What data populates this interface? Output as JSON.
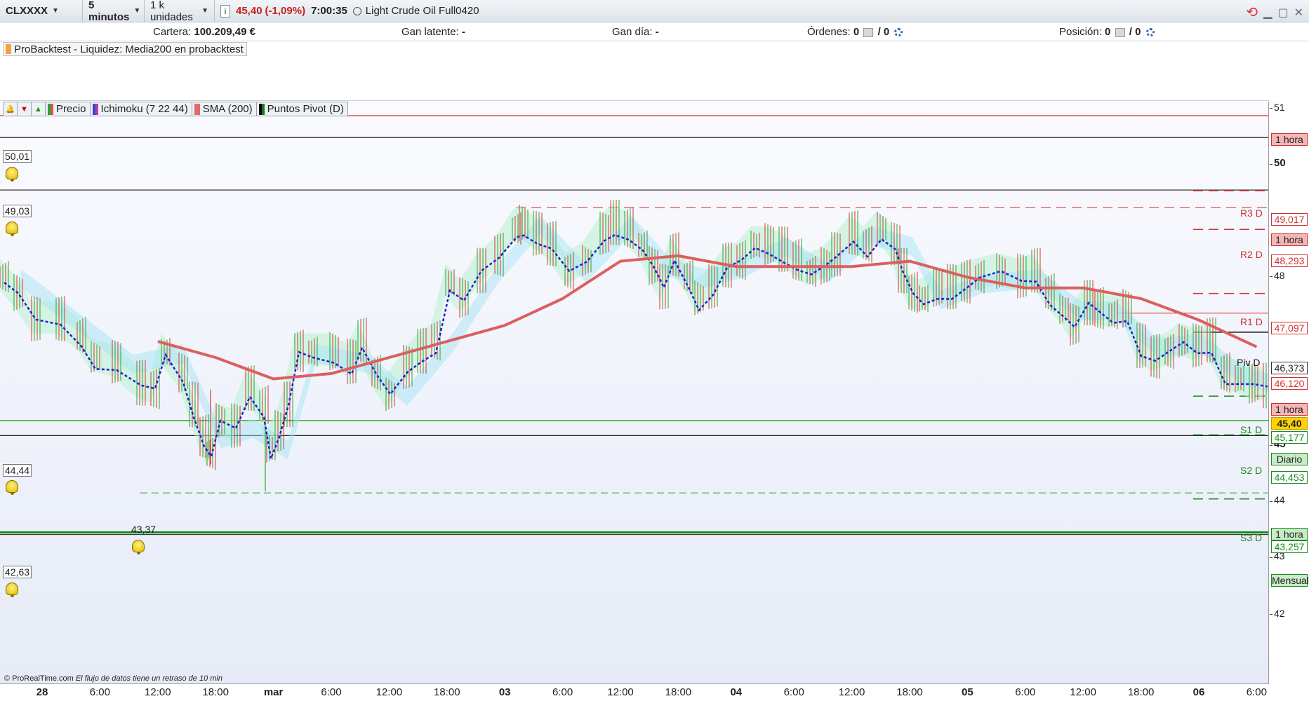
{
  "toolbar": {
    "symbol": "CLXXXX",
    "timeframe": "5 minutos",
    "units": "1 k unidades",
    "info_icon": "info-icon",
    "price": "45,40",
    "change": "(-1,09%)",
    "time": "7:00:35",
    "instrument": "Light Crude Oil Full0420"
  },
  "account": {
    "cartera_label": "Cartera:",
    "cartera_value": "100.209,49 €",
    "latente_label": "Gan latente:",
    "latente_value": "-",
    "dia_label": "Gan día:",
    "dia_value": "-",
    "ordenes_label": "Órdenes:",
    "ordenes_a": "0",
    "ordenes_b": "/ 0",
    "posicion_label": "Posición:",
    "posicion_a": "0",
    "posicion_b": "/ 0"
  },
  "probacktest": {
    "label": "ProBacktest - Liquidez: Media200 en probacktest"
  },
  "legend": {
    "items": [
      {
        "label": "Precio",
        "color": "#e05252"
      },
      {
        "label": "Ichimoku (7 22 44)",
        "color": "#4040d0"
      },
      {
        "label": "SMA (200)",
        "color": "#e06b6b"
      },
      {
        "label": "Puntos Pivot (D)",
        "color": "#1a7a1a"
      }
    ]
  },
  "axis": {
    "ticks": [
      "51",
      "50",
      "48",
      "45",
      "44",
      "43",
      "42"
    ],
    "bold_ticks": [
      "50",
      "45"
    ]
  },
  "lines": {
    "label_50_01": "50,01",
    "label_49_03": "49,03",
    "label_44_44": "44,44",
    "label_43_37": "43,37",
    "label_42_63": "42,63"
  },
  "tags": {
    "hora": "1 hora",
    "r3": "49,017",
    "r2": "48,293",
    "r1": "47,097",
    "piv": "46,373",
    "sma": "46,120",
    "price": "45,40",
    "s1": "45,177",
    "diario": "Diario",
    "s2": "44,453",
    "s3": "43,257",
    "mensual": "Mensual",
    "r3_name": "R3 D",
    "r2_name": "R2 D",
    "r1_name": "R1 D",
    "piv_name": "Piv D",
    "s1_name": "S1 D",
    "s2_name": "S2 D",
    "s3_name": "S3 D"
  },
  "time_axis": {
    "labels": [
      "28",
      "6:00",
      "12:00",
      "18:00",
      "mar",
      "6:00",
      "12:00",
      "18:00",
      "03",
      "6:00",
      "12:00",
      "18:00",
      "04",
      "6:00",
      "12:00",
      "18:00",
      "05",
      "6:00",
      "12:00",
      "18:00",
      "06",
      "6:00"
    ],
    "bold": [
      "28",
      "mar",
      "03",
      "04",
      "05",
      "06"
    ]
  },
  "footer": {
    "copyright": "© ProRealTime.com",
    "delay_note": "El flujo de datos tiene un retraso de 10 min"
  },
  "chart_data": {
    "type": "line",
    "instrument": "Light Crude Oil Full0420",
    "timeframe": "5 minutos",
    "x": [
      "28 0:00",
      "28 6:00",
      "28 12:00",
      "28 18:00",
      "mar 0:00",
      "mar 6:00",
      "mar 12:00",
      "mar 18:00",
      "03 0:00",
      "03 6:00",
      "03 12:00",
      "03 18:00",
      "04 0:00",
      "04 6:00",
      "04 12:00",
      "04 18:00",
      "05 0:00",
      "05 6:00",
      "05 12:00",
      "05 18:00",
      "06 0:00",
      "06 6:00"
    ],
    "series": [
      {
        "name": "Precio",
        "values": [
          47.2,
          46.6,
          45.9,
          45.2,
          44.6,
          46.0,
          45.4,
          46.8,
          48.2,
          47.4,
          48.4,
          47.9,
          47.0,
          47.8,
          47.3,
          48.0,
          47.0,
          47.3,
          47.2,
          46.4,
          45.9,
          45.4
        ]
      },
      {
        "name": "SMA (200)",
        "values": [
          null,
          null,
          46.2,
          45.9,
          45.5,
          45.6,
          45.9,
          46.2,
          46.5,
          47.0,
          47.7,
          47.8,
          47.6,
          47.6,
          47.6,
          47.7,
          47.4,
          47.2,
          47.2,
          47.0,
          46.6,
          46.1
        ]
      }
    ],
    "ylim": [
      42,
      51
    ],
    "grid": false
  }
}
